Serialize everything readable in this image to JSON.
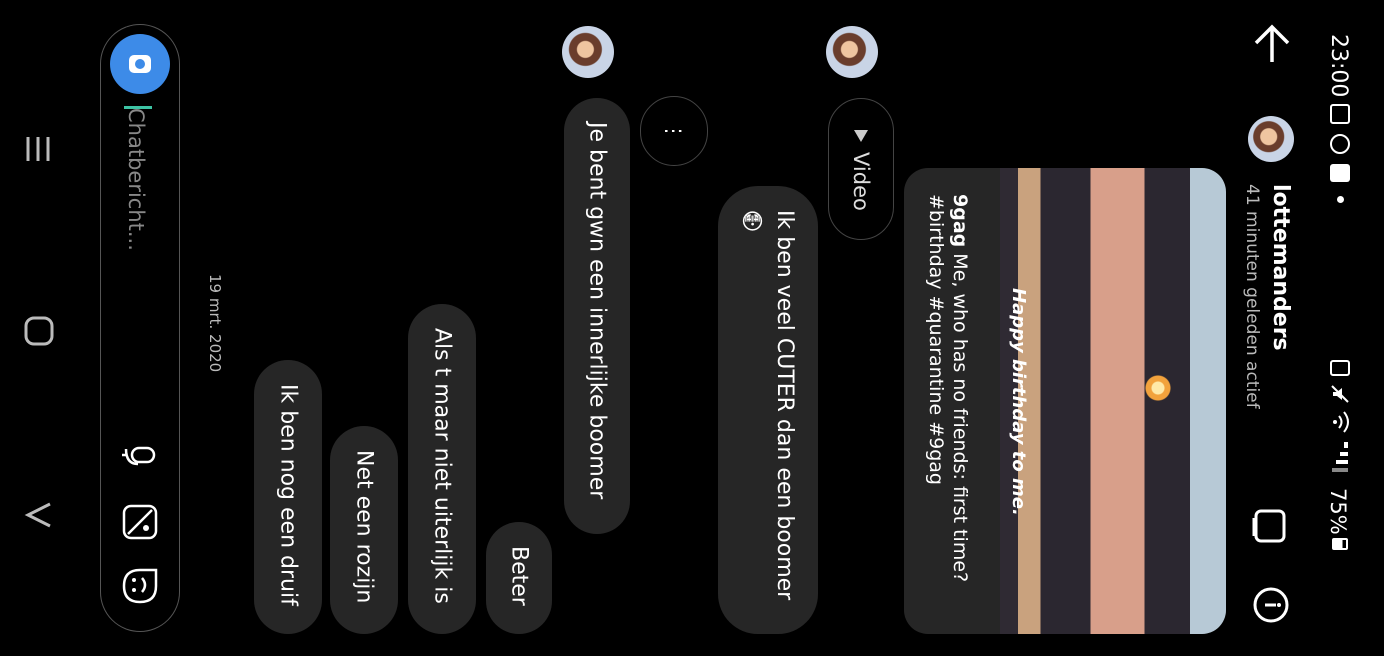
{
  "status": {
    "time": "23:00",
    "battery": "75%"
  },
  "header": {
    "username": "lottemanders",
    "active": "41 minuten geleden actief"
  },
  "post": {
    "image_text": "Happy birthday to me.",
    "author": "9gag",
    "caption": "Me, who has no friends: first time? #birthday #quarantine #9gag"
  },
  "video_pill": {
    "label": "Video"
  },
  "more_pill": {
    "label": "⋮"
  },
  "messages": {
    "m1": "Ik ben veel CUTER dan een boomer",
    "m1_emoji": "😳",
    "m2": "Je bent gwn een innerlijke boomer",
    "m3": "Beter",
    "m4": "Als t maar niet uiterlijk is",
    "m5": "Net een rozijn",
    "m6": "Ik ben nog een druif"
  },
  "date_label": "19 mrt. 2020",
  "composer": {
    "placeholder": "Chatbericht..."
  }
}
